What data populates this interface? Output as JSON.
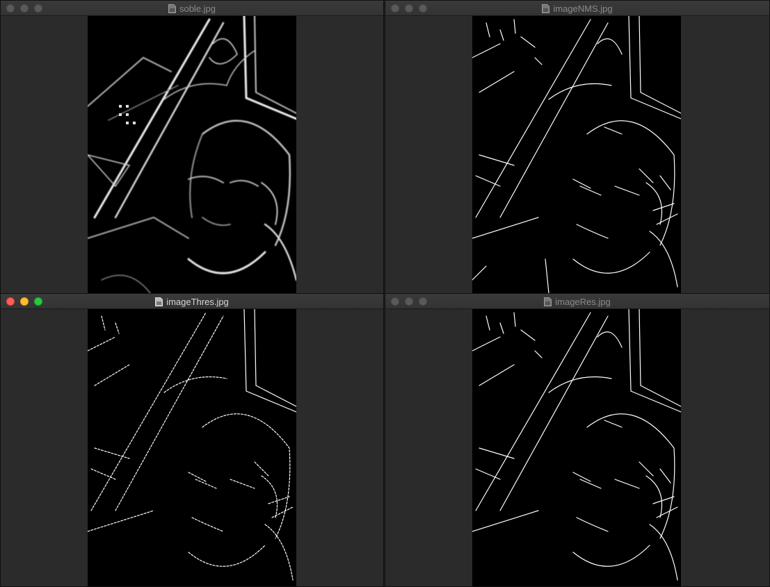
{
  "windows": [
    {
      "title": "soble.jpg",
      "active": false,
      "image": "sobel-gradient-magnitude"
    },
    {
      "title": "imageNMS.jpg",
      "active": false,
      "image": "non-max-suppression-edges"
    },
    {
      "title": "imageThres.jpg",
      "active": true,
      "image": "double-threshold-edges"
    },
    {
      "title": "imageRes.jpg",
      "active": false,
      "image": "hysteresis-result-edges"
    }
  ],
  "icons": {
    "traffic_lights": [
      "close-button",
      "minimize-button",
      "zoom-button"
    ],
    "title_icon": "image-file-icon"
  },
  "colors": {
    "close": "#fe5f57",
    "minimize": "#febc2e",
    "zoom": "#28c840",
    "inactive_light": "#5a5a5a",
    "window_bg": "#2b2b2b"
  }
}
